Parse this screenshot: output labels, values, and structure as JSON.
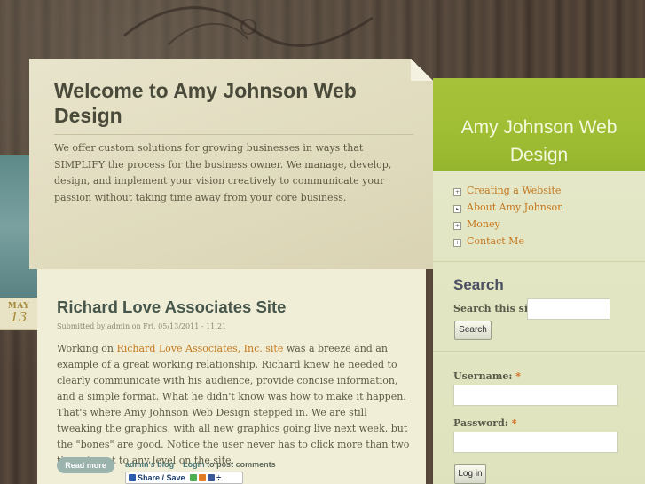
{
  "hero": {
    "title": "Welcome to Amy Johnson Web Design",
    "intro": "We offer custom solutions for growing businesses in ways that SIMPLIFY the process for the business owner. We manage, develop, design, and implement your vision creatively to communicate your passion without taking time away from your core business."
  },
  "post": {
    "date_month": "MAY",
    "date_day": "13",
    "title": "Richard Love Associates Site",
    "submitted": "Submitted by admin on Fri, 05/13/2011 - 11:21",
    "body_prefix": "Working on ",
    "body_link": "Richard Love Associates, Inc. site",
    "body_rest": " was a breeze and an example of a great working relationship. Richard knew he needed to clearly communicate with his audience, provide concise information, and a simple format. What he didn't know was how to make it happen. That's where Amy Johnson Web Design stepped in. We are still tweaking the graphics, with all new graphics going live next week, but the \"bones\" are good. Notice the user never has to click more than two times to get to any level on the site.",
    "read_more": "Read more",
    "blog_link": "admin's blog",
    "login_link": "Login",
    "login_suffix": " to post comments",
    "share_label": "Share / Save"
  },
  "sidebar": {
    "site_name": "Amy Johnson Web Design",
    "menu": [
      {
        "label": "Creating a Website",
        "expand": "+"
      },
      {
        "label": "About Amy Johnson",
        "expand": "▸"
      },
      {
        "label": "Money",
        "expand": "+"
      },
      {
        "label": "Contact Me",
        "expand": "+"
      }
    ],
    "search_heading": "Search",
    "search_label": "Search this site:",
    "search_button": "Search",
    "username_label": "Username:",
    "password_label": "Password:",
    "required_mark": "*",
    "login_button": "Log in"
  },
  "colors": {
    "accent_green": "#a7c23a",
    "link_orange": "#c47a1f",
    "paper": "#e8e4cc"
  }
}
